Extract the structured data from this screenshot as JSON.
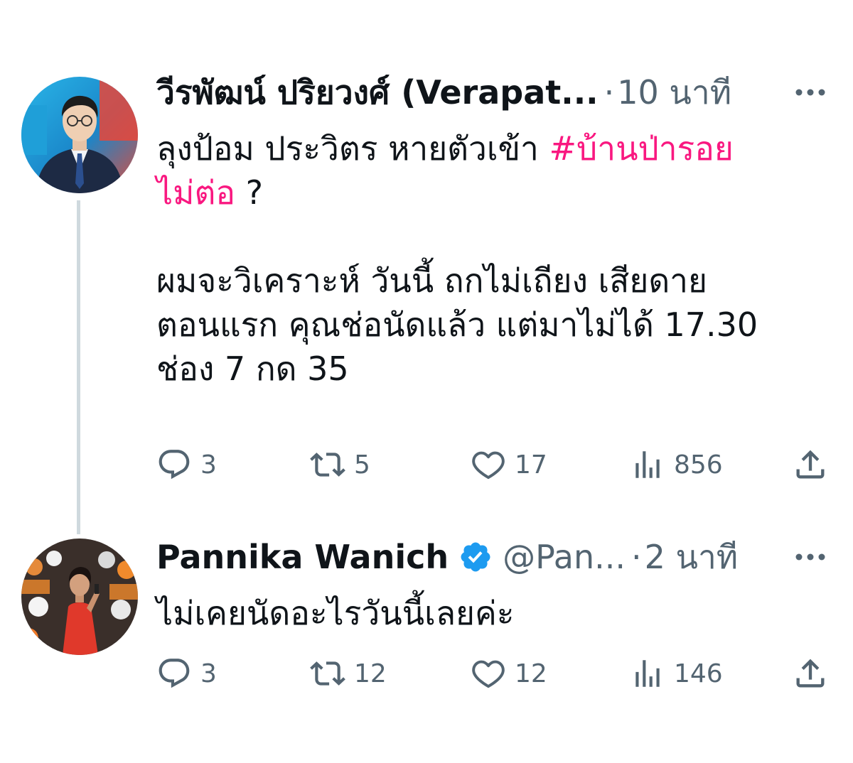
{
  "tweets": [
    {
      "author": {
        "display_name": "วีรพัฒน์ ปริยวงศ์ (Verapat...",
        "handle": "",
        "verified": false
      },
      "timestamp": "10 นาที",
      "text_before": "ลุงป้อม ประวิตร หายตัวเข้า ",
      "hashtag": "#บ้านป่ารอย\nไม่ต่อ",
      "text_after": " ?\n\nผมจะวิเคราะห์ วันนี้ ถกไม่เถียง เสียดาย\nตอนแรก คุณช่อนัดแล้ว แต่มาไม่ได้ 17.30\nช่อง 7 กด 35",
      "metrics": {
        "replies": "3",
        "retweets": "5",
        "likes": "17",
        "views": "856"
      }
    },
    {
      "author": {
        "display_name": "Pannika Wanich",
        "handle": "@Pan...",
        "verified": true
      },
      "timestamp": "2 นาที",
      "text": "ไม่เคยนัดอะไรวันนี้เลยค่ะ",
      "metrics": {
        "replies": "3",
        "retweets": "12",
        "likes": "12",
        "views": "146"
      }
    }
  ],
  "separator": "·",
  "icons": {
    "more": "more-horizontal-icon",
    "reply": "reply-icon",
    "retweet": "retweet-icon",
    "like": "heart-icon",
    "views": "views-bar-chart-icon",
    "share": "share-icon",
    "verified": "verified-badge-icon"
  },
  "colors": {
    "text": "#0f1419",
    "secondary": "#536471",
    "hashtag": "#f91880",
    "verified": "#1d9bf0",
    "thread_line": "#cfd9de"
  }
}
